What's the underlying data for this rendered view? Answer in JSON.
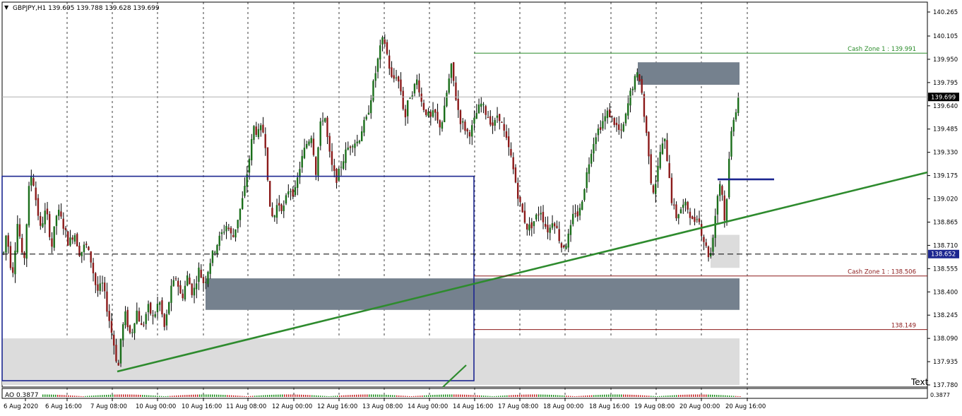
{
  "header": {
    "arrow": "▼",
    "text": "GBPJPY,H1  139.695 139.788 139.628 139.699"
  },
  "chart_data": {
    "type": "candlestick",
    "symbol": "GBPJPY",
    "timeframe": "H1",
    "ohlc_last": {
      "open": 139.695,
      "high": 139.788,
      "low": 139.628,
      "close": 139.699
    },
    "ylim": [
      137.78,
      140.22
    ],
    "y_ticks": [
      "140.265",
      "140.105",
      "139.950",
      "139.795",
      "139.640",
      "139.485",
      "139.330",
      "139.175",
      "139.020",
      "138.865",
      "138.710",
      "138.555",
      "138.400",
      "138.245",
      "138.090",
      "137.935",
      "137.780"
    ],
    "x_ticks": [
      "6 Aug 2020",
      "6 Aug 16:00",
      "7 Aug 08:00",
      "10 Aug 00:00",
      "10 Aug 16:00",
      "11 Aug 08:00",
      "12 Aug 00:00",
      "12 Aug 16:00",
      "13 Aug 08:00",
      "14 Aug 00:00",
      "14 Aug 16:00",
      "17 Aug 08:00",
      "18 Aug 00:00",
      "18 Aug 16:00",
      "19 Aug 08:00",
      "20 Aug 00:00",
      "20 Aug 16:00"
    ],
    "current_price": "139.699",
    "hline_price": "138.652",
    "levels": [
      {
        "label": "Cash Zone 1 : 139.991",
        "price": 139.991,
        "color": "#2a8c2a"
      },
      {
        "label": "Cash Zone 1 : 138.506",
        "price": 138.506,
        "color": "#8b1a1a"
      },
      {
        "label": "138.149",
        "price": 138.149,
        "color": "#8b1a1a"
      }
    ],
    "path": [
      [
        0,
        138.52
      ],
      [
        8,
        138.8
      ],
      [
        16,
        138.5
      ],
      [
        24,
        138.88
      ],
      [
        32,
        138.55
      ],
      [
        40,
        139.1
      ],
      [
        44,
        139.2
      ],
      [
        50,
        139.0
      ],
      [
        56,
        138.82
      ],
      [
        64,
        138.95
      ],
      [
        72,
        138.7
      ],
      [
        80,
        138.95
      ],
      [
        88,
        138.85
      ],
      [
        96,
        138.72
      ],
      [
        104,
        138.8
      ],
      [
        112,
        138.65
      ],
      [
        120,
        138.72
      ],
      [
        128,
        138.6
      ],
      [
        136,
        138.4
      ],
      [
        144,
        138.45
      ],
      [
        152,
        138.25
      ],
      [
        160,
        138.05
      ],
      [
        166,
        137.88
      ],
      [
        170,
        138.1
      ],
      [
        176,
        138.25
      ],
      [
        184,
        138.1
      ],
      [
        192,
        138.28
      ],
      [
        200,
        138.15
      ],
      [
        208,
        138.3
      ],
      [
        216,
        138.22
      ],
      [
        224,
        138.35
      ],
      [
        232,
        138.15
      ],
      [
        240,
        138.4
      ],
      [
        248,
        138.5
      ],
      [
        256,
        138.35
      ],
      [
        264,
        138.5
      ],
      [
        272,
        138.38
      ],
      [
        280,
        138.55
      ],
      [
        288,
        138.45
      ],
      [
        296,
        138.6
      ],
      [
        304,
        138.7
      ],
      [
        312,
        138.78
      ],
      [
        320,
        138.85
      ],
      [
        328,
        138.75
      ],
      [
        336,
        138.9
      ],
      [
        344,
        139.05
      ],
      [
        352,
        139.3
      ],
      [
        358,
        139.5
      ],
      [
        364,
        139.45
      ],
      [
        370,
        139.5
      ],
      [
        376,
        139.35
      ],
      [
        380,
        138.95
      ],
      [
        386,
        138.88
      ],
      [
        392,
        139.0
      ],
      [
        400,
        138.95
      ],
      [
        408,
        139.1
      ],
      [
        416,
        139.05
      ],
      [
        424,
        139.25
      ],
      [
        432,
        139.38
      ],
      [
        440,
        139.45
      ],
      [
        446,
        139.2
      ],
      [
        452,
        139.5
      ],
      [
        458,
        139.6
      ],
      [
        464,
        139.35
      ],
      [
        470,
        139.2
      ],
      [
        476,
        139.15
      ],
      [
        482,
        139.25
      ],
      [
        490,
        139.35
      ],
      [
        498,
        139.4
      ],
      [
        506,
        139.4
      ],
      [
        512,
        139.5
      ],
      [
        518,
        139.55
      ],
      [
        524,
        139.7
      ],
      [
        530,
        139.85
      ],
      [
        536,
        140.0
      ],
      [
        542,
        140.1
      ],
      [
        548,
        139.95
      ],
      [
        554,
        139.8
      ],
      [
        560,
        139.85
      ],
      [
        566,
        139.75
      ],
      [
        572,
        139.55
      ],
      [
        578,
        139.7
      ],
      [
        584,
        139.75
      ],
      [
        590,
        139.82
      ],
      [
        596,
        139.65
      ],
      [
        602,
        139.6
      ],
      [
        608,
        139.55
      ],
      [
        614,
        139.6
      ],
      [
        620,
        139.5
      ],
      [
        626,
        139.55
      ],
      [
        632,
        139.75
      ],
      [
        638,
        139.9
      ],
      [
        644,
        139.7
      ],
      [
        650,
        139.55
      ],
      [
        656,
        139.5
      ],
      [
        662,
        139.45
      ],
      [
        668,
        139.5
      ],
      [
        674,
        139.6
      ],
      [
        680,
        139.65
      ],
      [
        686,
        139.6
      ],
      [
        692,
        139.55
      ],
      [
        698,
        139.5
      ],
      [
        704,
        139.6
      ],
      [
        710,
        139.5
      ],
      [
        716,
        139.4
      ],
      [
        722,
        139.3
      ],
      [
        728,
        139.15
      ],
      [
        734,
        139.0
      ],
      [
        740,
        138.9
      ],
      [
        746,
        138.82
      ],
      [
        752,
        138.85
      ],
      [
        758,
        138.9
      ],
      [
        764,
        138.95
      ],
      [
        770,
        138.85
      ],
      [
        776,
        138.8
      ],
      [
        782,
        138.9
      ],
      [
        788,
        138.8
      ],
      [
        794,
        138.7
      ],
      [
        800,
        138.72
      ],
      [
        806,
        138.8
      ],
      [
        812,
        138.95
      ],
      [
        818,
        138.9
      ],
      [
        824,
        139.05
      ],
      [
        830,
        139.2
      ],
      [
        836,
        139.35
      ],
      [
        842,
        139.45
      ],
      [
        848,
        139.5
      ],
      [
        854,
        139.55
      ],
      [
        860,
        139.6
      ],
      [
        866,
        139.55
      ],
      [
        872,
        139.5
      ],
      [
        878,
        139.45
      ],
      [
        884,
        139.55
      ],
      [
        890,
        139.7
      ],
      [
        896,
        139.8
      ],
      [
        902,
        139.85
      ],
      [
        906,
        139.8
      ],
      [
        910,
        139.6
      ],
      [
        914,
        139.45
      ],
      [
        918,
        139.3
      ],
      [
        922,
        139.05
      ],
      [
        928,
        139.15
      ],
      [
        934,
        139.35
      ],
      [
        940,
        139.4
      ],
      [
        946,
        139.2
      ],
      [
        950,
        139.0
      ],
      [
        956,
        138.9
      ],
      [
        962,
        138.95
      ],
      [
        968,
        138.98
      ],
      [
        974,
        138.95
      ],
      [
        980,
        138.85
      ],
      [
        986,
        138.92
      ],
      [
        992,
        138.8
      ],
      [
        998,
        138.7
      ],
      [
        1004,
        138.62
      ],
      [
        1010,
        138.85
      ],
      [
        1016,
        139.1
      ],
      [
        1020,
        139.15
      ],
      [
        1024,
        138.85
      ],
      [
        1028,
        139.05
      ],
      [
        1032,
        139.35
      ],
      [
        1036,
        139.55
      ],
      [
        1040,
        139.6
      ],
      [
        1044,
        139.7
      ]
    ]
  },
  "annotations": {
    "text_label": "Text",
    "ao_label": "AO 0.3877",
    "ao_right": "0.3877"
  }
}
